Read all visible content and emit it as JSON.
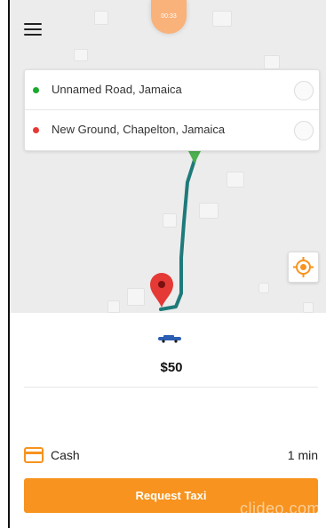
{
  "status": {
    "timer": "00:33"
  },
  "map": {
    "pickup_pin_color": "#4caf50",
    "dropoff_pin_color": "#e53935",
    "route_color": "#1f7a7a"
  },
  "addresses": {
    "pickup": {
      "text": "Unnamed Road, Jamaica",
      "dot_color": "#1aaa2c"
    },
    "dropoff": {
      "text": "New Ground, Chapelton, Jamaica",
      "dot_color": "#e53935"
    }
  },
  "ride": {
    "vehicle_icon": "car-icon",
    "fare": "$50"
  },
  "payment": {
    "method": "Cash",
    "icon": "credit-card-icon",
    "eta": "1 min"
  },
  "actions": {
    "request_label": "Request Taxi",
    "accent": "#f7931e"
  },
  "watermark": "clideo.com"
}
